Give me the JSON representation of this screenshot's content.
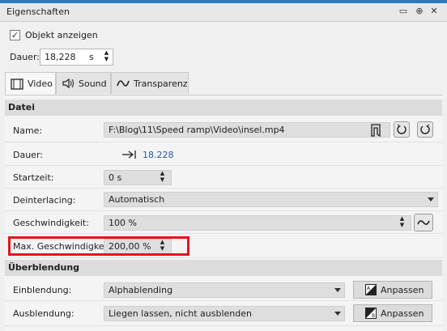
{
  "window": {
    "title": "Eigenschaften",
    "controls": [
      "▭",
      "⊕",
      "✕"
    ]
  },
  "show_object": {
    "checked": true,
    "label": "Objekt anzeigen"
  },
  "duration": {
    "label": "Dauer:",
    "value": "18,228",
    "unit": "s"
  },
  "tabs": [
    {
      "label": "Video",
      "icon": "film-icon",
      "active": true
    },
    {
      "label": "Sound",
      "icon": "speaker-icon",
      "active": false
    },
    {
      "label": "Transparenz",
      "icon": "transparency-icon",
      "active": false
    }
  ],
  "sections": {
    "datei": {
      "title": "Datei",
      "name": {
        "label": "Name:",
        "value": "F:\\Blog\\11\\Speed ramp\\Video\\insel.mp4"
      },
      "duration": {
        "label": "Dauer:",
        "value": "18.228"
      },
      "start_time": {
        "label": "Startzeit:",
        "value": "0 s"
      },
      "deinterlacing": {
        "label": "Deinterlacing:",
        "value": "Automatisch"
      },
      "speed": {
        "label": "Geschwindigkeit:",
        "value": "100 %"
      },
      "max_speed": {
        "label": "Max. Geschwindigkeit:",
        "value": "200,00 %"
      }
    },
    "ueberblendung": {
      "title": "Überblendung",
      "fade_in": {
        "label": "Einblendung:",
        "value": "Alphablending",
        "button": "Anpassen"
      },
      "fade_out": {
        "label": "Ausblendung:",
        "value": "Liegen lassen, nicht ausblenden",
        "button": "Anpassen"
      }
    }
  },
  "colors": {
    "accent": "#2b79c2",
    "highlight": "#e4141b"
  }
}
